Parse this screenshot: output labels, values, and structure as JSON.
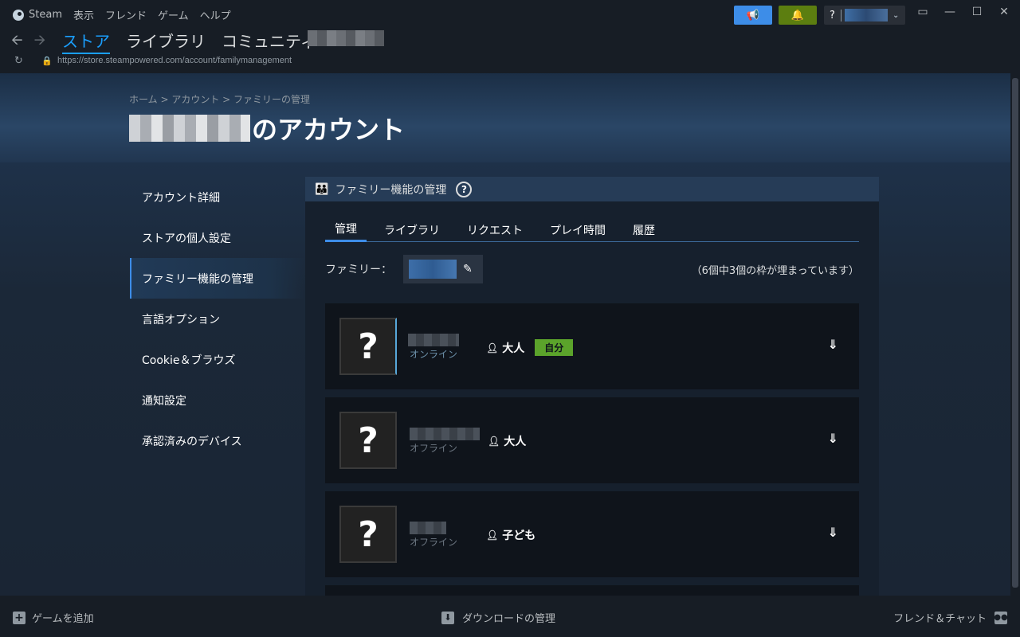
{
  "menu": {
    "app_name": "Steam",
    "items": [
      "表示",
      "フレンド",
      "ゲーム",
      "ヘルプ"
    ]
  },
  "titlebar": {
    "help_label": "?"
  },
  "nav": {
    "links": [
      "ストア",
      "ライブラリ",
      "コミュニティ"
    ]
  },
  "url": "https://store.steampowered.com/account/familymanagement",
  "breadcrumb": "ホーム > アカウント > ファミリーの管理",
  "page_title_suffix": "のアカウント",
  "sidebar": {
    "items": [
      "アカウント詳細",
      "ストアの個人設定",
      "ファミリー機能の管理",
      "言語オプション",
      "Cookie＆ブラウズ",
      "通知設定",
      "承認済みのデバイス"
    ]
  },
  "panel": {
    "title": "ファミリー機能の管理",
    "help_label": "?",
    "tabs": [
      "管理",
      "ライブラリ",
      "リクエスト",
      "プレイ時間",
      "履歴"
    ],
    "family_label": "ファミリー：",
    "slots_text": "（6個中3個の枠が埋まっています）",
    "members": [
      {
        "status": "オンライン",
        "role": "大人",
        "badge": "自分"
      },
      {
        "status": "オフライン",
        "role": "大人"
      },
      {
        "status": "オフライン",
        "role": "子ども"
      }
    ]
  },
  "bottombar": {
    "add_game": "ゲームを追加",
    "downloads": "ダウンロードの管理",
    "friends": "フレンド＆チャット"
  },
  "colors": {
    "accent": "#1a9fff",
    "announce_button": "#3d8de8",
    "bell_button": "#5c7e10",
    "self_badge": "#5ba32b",
    "panel_header": "#263c57"
  },
  "icons": {
    "announce": "megaphone-icon",
    "bell": "bell-icon",
    "family": "family-icon",
    "edit": "pencil-icon",
    "expand": "double-chevron-down-icon"
  }
}
